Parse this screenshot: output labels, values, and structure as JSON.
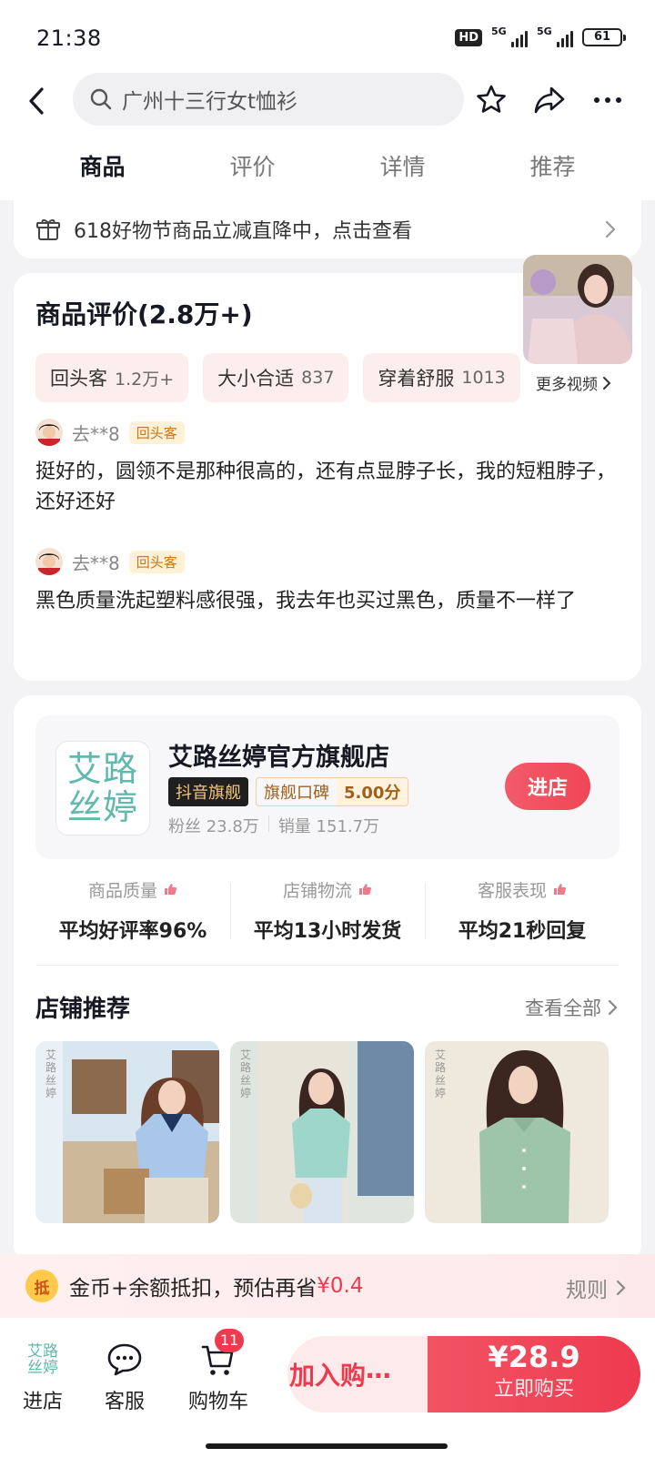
{
  "status_bar": {
    "time": "21:38",
    "hd": "HD",
    "net1": "5G",
    "net2": "5G",
    "battery": "61"
  },
  "search": {
    "placeholder": "广州十三行女t恤衫"
  },
  "tabs": [
    {
      "label": "商品",
      "active": true
    },
    {
      "label": "评价",
      "active": false
    },
    {
      "label": "详情",
      "active": false
    },
    {
      "label": "推荐",
      "active": false
    }
  ],
  "promo": {
    "text": "618好物节商品立减直降中，点击查看"
  },
  "reviews": {
    "title": "商品评价(2.8万+)",
    "more_videos": "更多视频",
    "chips": [
      {
        "label": "回头客",
        "count": "1.2万+"
      },
      {
        "label": "大小合适",
        "count": "837"
      },
      {
        "label": "穿着舒服",
        "count": "1013"
      }
    ],
    "items": [
      {
        "user": "去**8",
        "badge": "回头客",
        "text": "挺好的，圆领不是那种很高的，还有点显脖子长，我的短粗脖子，还好还好"
      },
      {
        "user": "去**8",
        "badge": "回头客",
        "text": "黑色质量洗起塑料感很强，我去年也买过黑色，质量不一样了"
      }
    ]
  },
  "store": {
    "logo_line1": "艾路",
    "logo_line2": "丝婷",
    "name": "艾路丝婷官方旗舰店",
    "tag_douyin": "抖音旗舰",
    "tag_koubei": "旗舰口碑",
    "score": "5.00分",
    "fans": "粉丝 23.8万",
    "sales": "销量 151.7万",
    "enter_label": "进店",
    "metrics": [
      {
        "label": "商品质量",
        "value": "平均好评率96%"
      },
      {
        "label": "店铺物流",
        "value": "平均13小时发货"
      },
      {
        "label": "客服表现",
        "value": "平均21秒回复"
      }
    ],
    "rec_title": "店铺推荐",
    "see_all": "查看全部",
    "watermark": [
      "艾",
      "路",
      "丝",
      "婷"
    ]
  },
  "coin_bar": {
    "icon": "抵",
    "text": "金币+余额抵扣，预估再省",
    "amount": "¥0.4",
    "rule": "规则"
  },
  "bottom_bar": {
    "store_label": "进店",
    "service_label": "客服",
    "cart_label": "购物车",
    "cart_count": "11",
    "add_cart": "加入购⋯",
    "price": "¥28.9",
    "buy_now": "立即购买"
  },
  "colors": {
    "accent": "#ee3a4f",
    "brand_teal": "#5fb9ad",
    "chip_bg": "#fdeeee"
  }
}
